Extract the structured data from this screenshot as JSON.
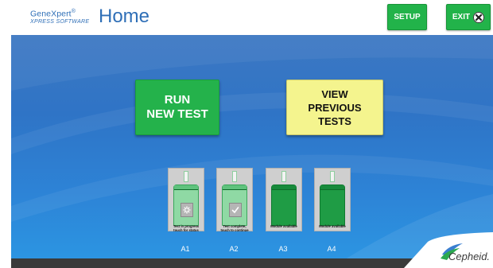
{
  "header": {
    "brand_line1": "GeneXpert",
    "brand_reg": "®",
    "brand_line2": "XPRESS SOFTWARE",
    "title": "Home",
    "setup_label": "SETUP",
    "exit_label": "EXIT"
  },
  "main": {
    "run_line1": "RUN",
    "run_line2": "NEW TEST",
    "view_line1": "VIEW",
    "view_line2": "PREVIOUS",
    "view_line3": "TESTS"
  },
  "modules": [
    {
      "label": "A1",
      "status_line1": "Test in progress",
      "status_line2": "touch for status"
    },
    {
      "label": "A2",
      "status_line1": "Test complete,",
      "status_line2": "touch to continue"
    },
    {
      "label": "A3",
      "status_line1": "Module available",
      "status_line2": ""
    },
    {
      "label": "A4",
      "status_line1": "Module available",
      "status_line2": ""
    }
  ],
  "footer": {
    "logo_text": "Cepheid."
  },
  "colors": {
    "accent_green": "#24b24b",
    "view_yellow": "#f4f48e",
    "brand_blue": "#2f6fb7"
  }
}
